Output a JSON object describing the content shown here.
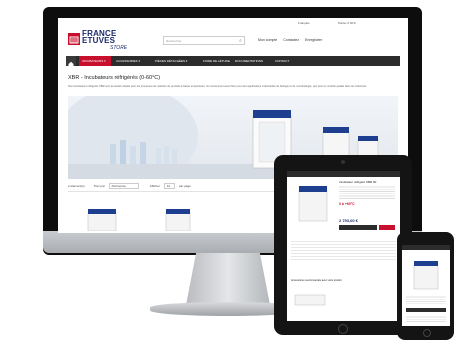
{
  "header": {
    "brand_line1": "FRANCE",
    "brand_line2": "ETUVES",
    "brand_sub": "STORE",
    "lang": "Français",
    "cart": "Panier 0,00 €",
    "search_placeholder": "Rechercher",
    "links": [
      "Mon compte",
      "Contactez",
      "Enregistrer"
    ]
  },
  "nav": {
    "items": [
      "INCUBATEURS ▾",
      "ACCESSOIRES ▾",
      "PIÈCES DÉTACHÉES ▾",
      "FOIRE DE LÉTUDE",
      "DOCUMENTATIONS",
      "CONTACT"
    ]
  },
  "main": {
    "title": "XBR - Incubateurs réfrigérés (0-60°C)",
    "description": "Nos incubateurs réfrigérés XBR sont la solution idéale pour les processus de maintien de produits à basse température. Ils conviennent aussi bien pour des applications industrielles de biologie et de microbiologie, que pour le contrôle qualité dans les industries.",
    "toolbar": {
      "count": "2 élément(s)",
      "sort_label": "Trier par",
      "sort_value": "Pertinence",
      "show_label": "Afficher",
      "show_value": "12",
      "per_page": "par page"
    }
  },
  "tablet": {
    "product_title": "Incubateur réfrigéré XBR 60",
    "temp_text": "0 à +60°C",
    "price": "2 793,00 €",
    "related": "Accessoires recommandés avec votre produit"
  },
  "colors": {
    "brand_red": "#c8102e",
    "brand_blue": "#1b2a6b",
    "nav_dark": "#2c2c2c"
  }
}
